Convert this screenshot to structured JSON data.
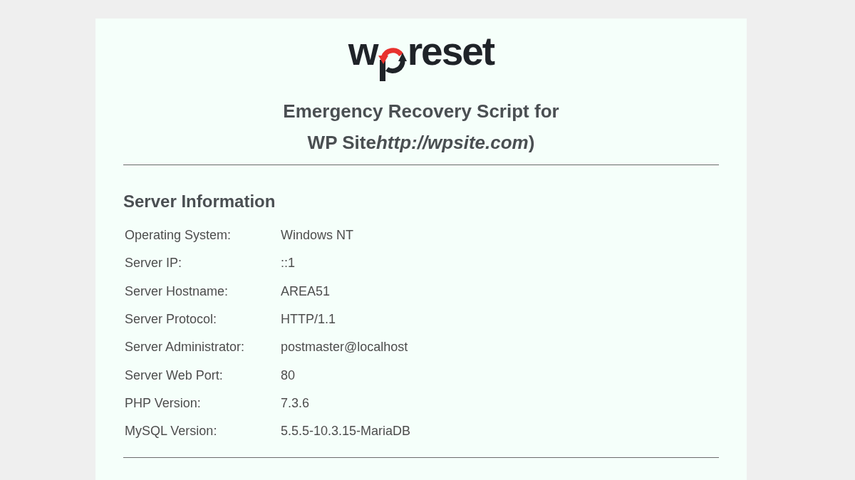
{
  "logo": {
    "text_before_icon": "w",
    "text_after_icon": "reset"
  },
  "title": {
    "text": "Emergency Recovery Script for WP Site",
    "site_url": "http://wpsite.com",
    "closing": ")"
  },
  "server_information": {
    "heading": "Server Information",
    "rows": [
      {
        "label": "Operating System:",
        "value": "Windows NT"
      },
      {
        "label": "Server IP:",
        "value": "::1"
      },
      {
        "label": "Server Hostname:",
        "value": "AREA51"
      },
      {
        "label": "Server Protocol:",
        "value": "HTTP/1.1"
      },
      {
        "label": "Server Administrator:",
        "value": "postmaster@localhost"
      },
      {
        "label": "Server Web Port:",
        "value": "80"
      },
      {
        "label": "PHP Version:",
        "value": "7.3.6"
      },
      {
        "label": "MySQL Version:",
        "value": "5.5.5-10.3.15-MariaDB"
      }
    ]
  }
}
